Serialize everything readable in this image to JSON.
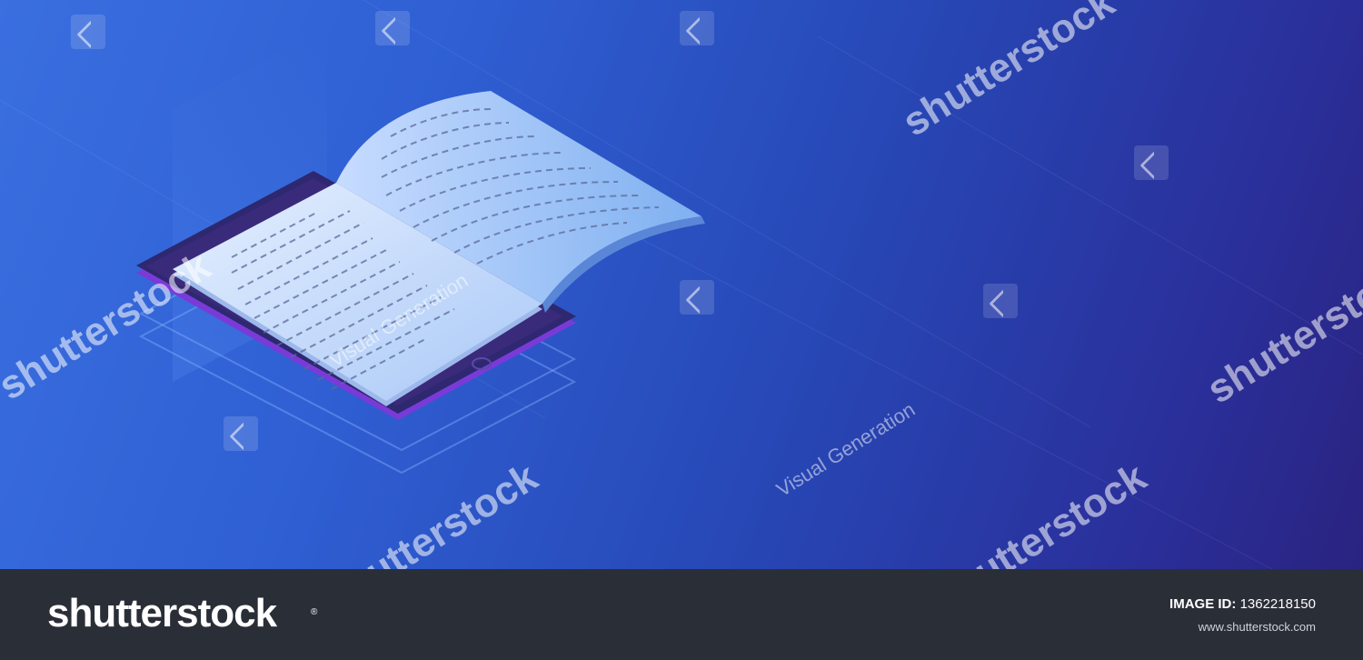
{
  "colors": {
    "background_light": "#3a6fe0",
    "background_dark": "#2a2380",
    "footer": "#2a2e37",
    "tablet": "#3a2a7a",
    "tablet_edge": "#7a3ad8",
    "page": "#cfe2ff",
    "page_text": "#5a6a9a"
  },
  "watermarks": {
    "brand": "shutterstock",
    "author": "Visual Generation"
  },
  "footer": {
    "logo_text": "shutterstock",
    "logo_mark": "®",
    "image_id_label": "IMAGE ID:",
    "image_id_value": "1362218150",
    "site": "www.shutterstock.com"
  }
}
